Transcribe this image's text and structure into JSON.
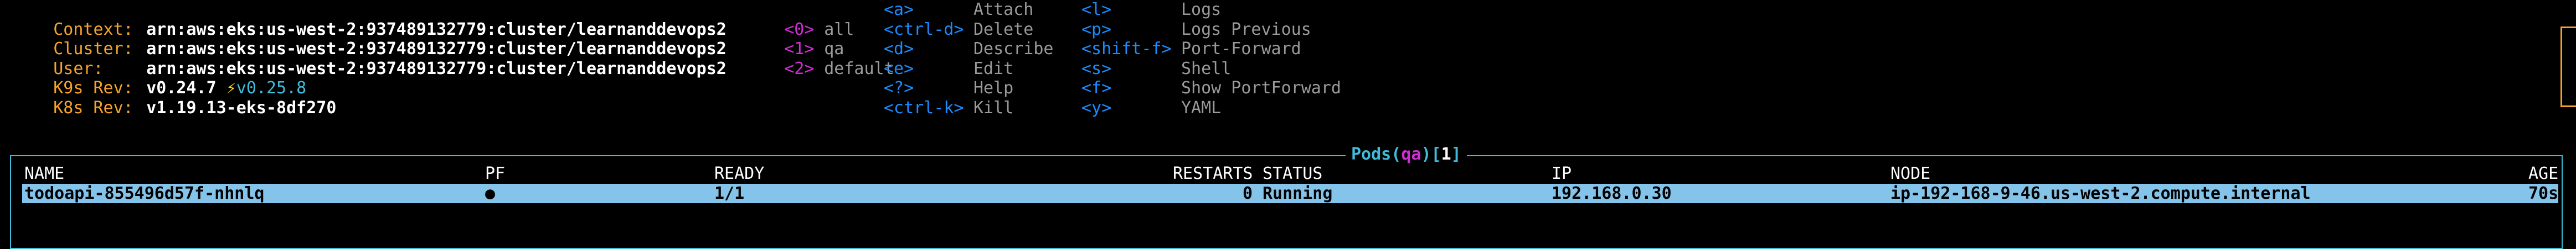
{
  "cluster_info": [
    {
      "label": "Context:",
      "value": "arn:aws:eks:us-west-2:937489132779:cluster/learnanddevops2"
    },
    {
      "label": "Cluster:",
      "value": "arn:aws:eks:us-west-2:937489132779:cluster/learnanddevops2"
    },
    {
      "label": "User:",
      "value": "arn:aws:eks:us-west-2:937489132779:cluster/learnanddevops2"
    },
    {
      "label": "K9s Rev:",
      "value": "v0.24.7",
      "bolt": "⚡",
      "latest": "v0.25.8"
    },
    {
      "label": "K8s Rev:",
      "value": "v1.19.13-eks-8df270"
    }
  ],
  "namespaces": [
    {
      "key": "<0>",
      "name": "all"
    },
    {
      "key": "<1>",
      "name": "qa"
    },
    {
      "key": "<2>",
      "name": "default"
    }
  ],
  "shortcuts_a": [
    {
      "key": "<a>",
      "desc": "Attach"
    },
    {
      "key": "<ctrl-d>",
      "desc": "Delete"
    },
    {
      "key": "<d>",
      "desc": "Describe"
    },
    {
      "key": "<e>",
      "desc": "Edit"
    },
    {
      "key": "<?>",
      "desc": "Help"
    },
    {
      "key": "<ctrl-k>",
      "desc": "Kill"
    }
  ],
  "shortcuts_b": [
    {
      "key": "<l>",
      "desc": "Logs"
    },
    {
      "key": "<p>",
      "desc": "Logs Previous"
    },
    {
      "key": "<shift-f>",
      "desc": "Port-Forward"
    },
    {
      "key": "<s>",
      "desc": "Shell"
    },
    {
      "key": "<f>",
      "desc": "Show PortForward"
    },
    {
      "key": "<y>",
      "desc": "YAML"
    }
  ],
  "table": {
    "title_resource": "Pods",
    "title_namespace": "qa",
    "title_count": "1",
    "columns": {
      "name": "NAME",
      "pf": "PF",
      "ready": "READY",
      "restarts": "RESTARTS",
      "status": "STATUS",
      "ip": "IP",
      "node": "NODE",
      "age": "AGE"
    },
    "rows": [
      {
        "name": "todoapi-855496d57f-nhnlq",
        "pf": "●",
        "ready": "1/1",
        "restarts": "0",
        "status": "Running",
        "ip": "192.168.0.30",
        "node": "ip-192-168-9-46.us-west-2.compute.internal",
        "age": "70s"
      }
    ]
  },
  "colors": {
    "label": "#f6a32a",
    "namespace_key": "#d22cd6",
    "shortcut_key": "#1a8cff",
    "muted_text": "#9a9a9a",
    "frame": "#3fbcd9",
    "selected_row": "#84c4ea"
  }
}
